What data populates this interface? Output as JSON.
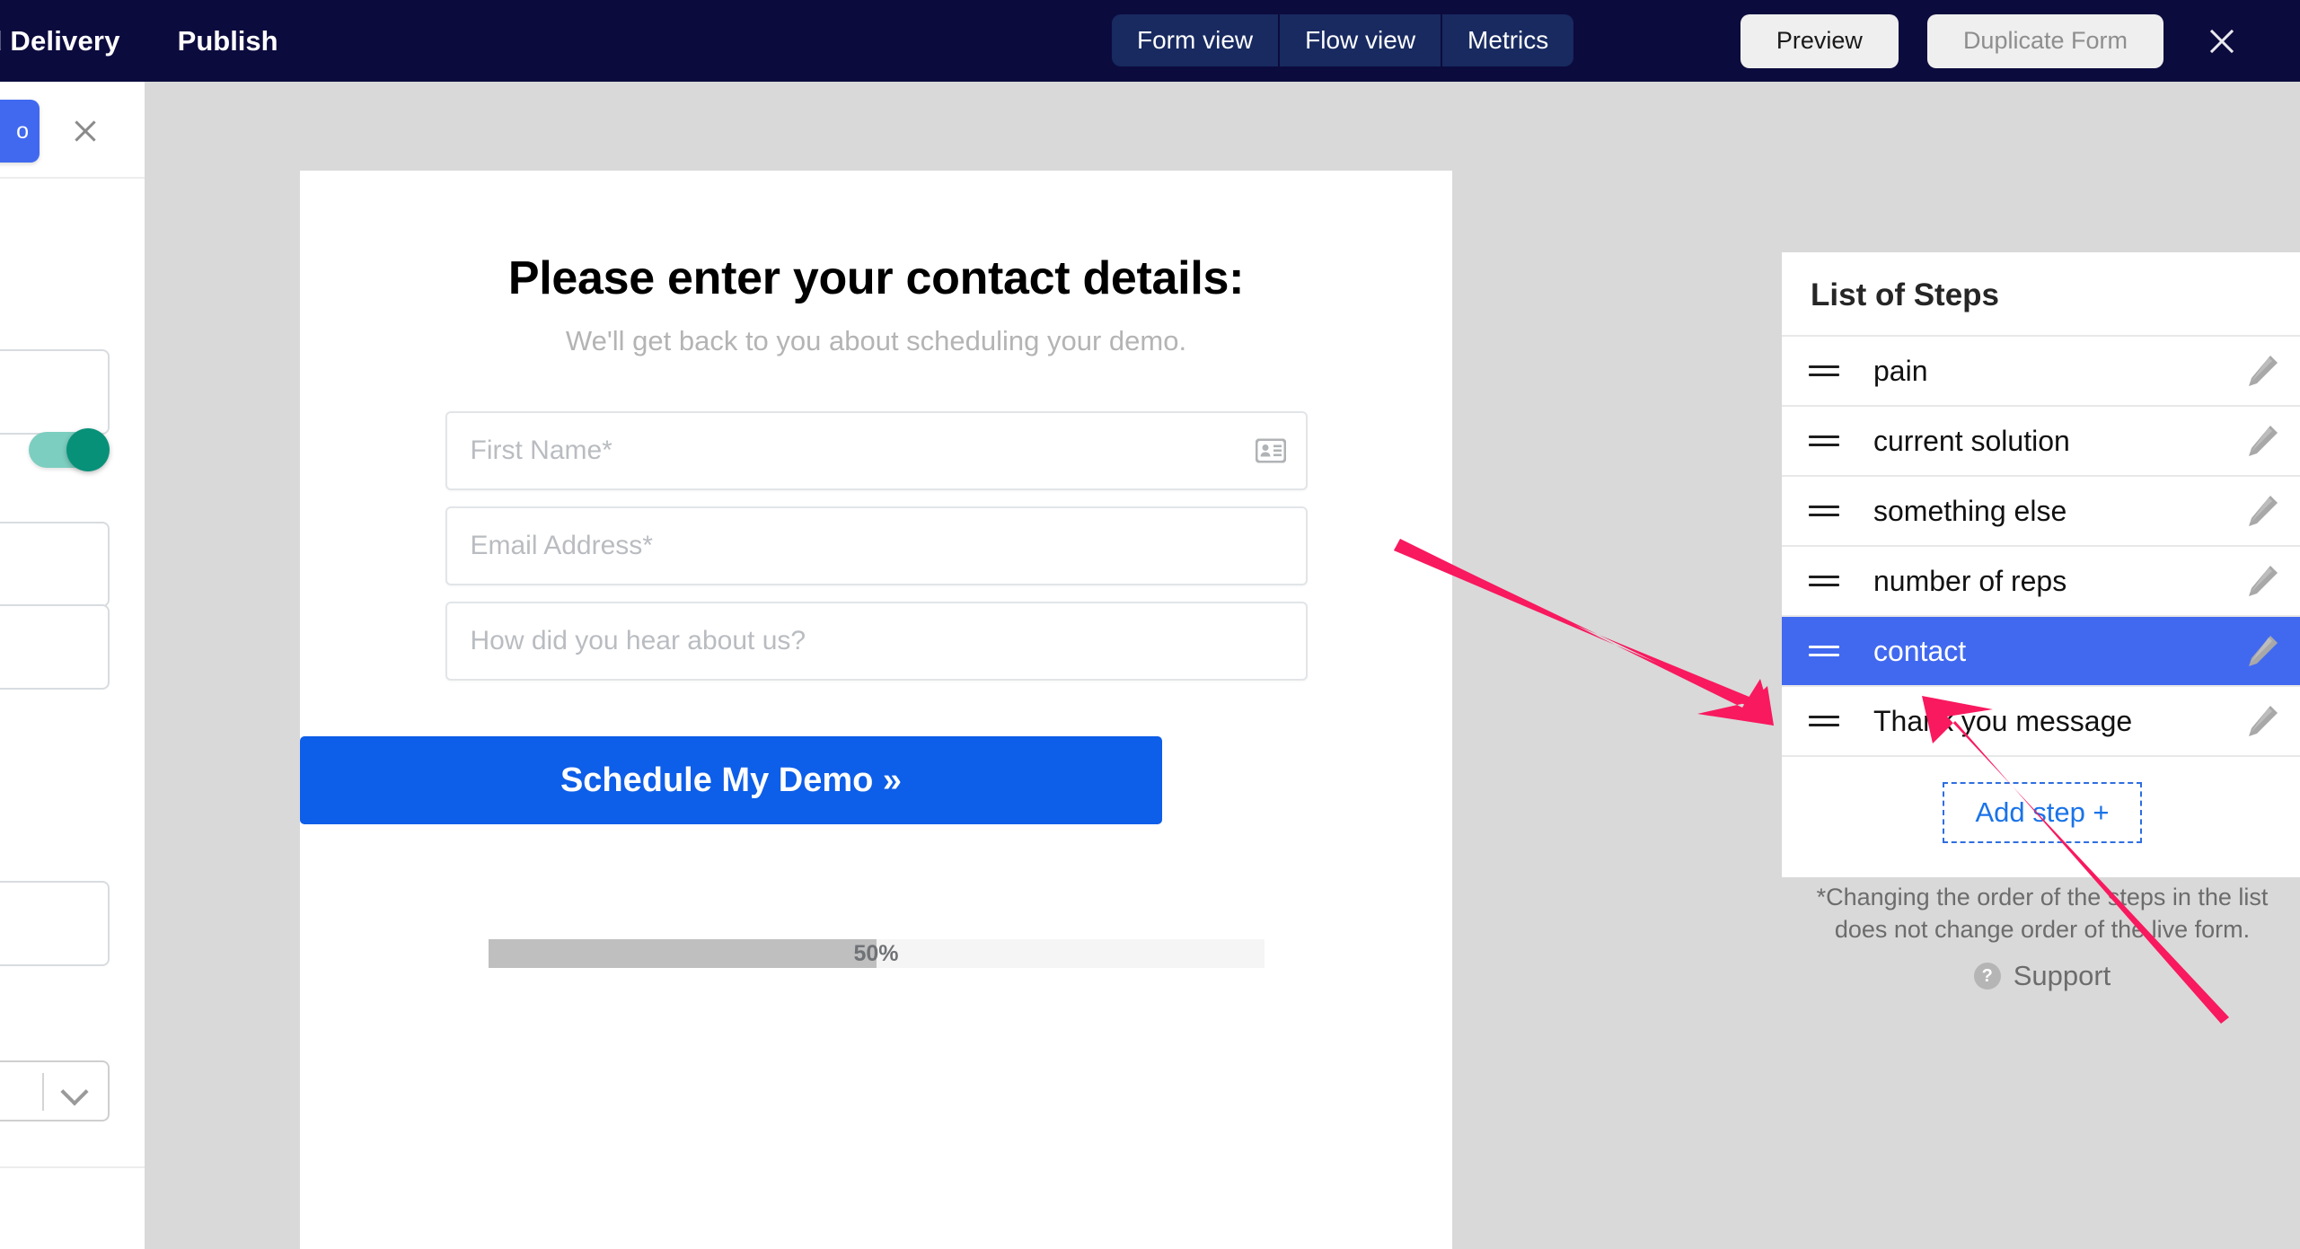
{
  "topbar": {
    "brand_title": "ad Delivery",
    "publish_label": "Publish",
    "view_tabs": [
      {
        "label": "Form view"
      },
      {
        "label": "Flow view"
      },
      {
        "label": "Metrics"
      }
    ],
    "preview_label": "Preview",
    "duplicate_label": "Duplicate Form",
    "close_icon": "close-icon"
  },
  "sidebar": {
    "blue_button_label": "o",
    "close_icon": "close-icon",
    "toggle_state": "on",
    "chevron_icon": "chevron-down-icon"
  },
  "form_preview": {
    "title": "Please enter your contact details:",
    "subtitle": "We'll get back to you about scheduling your demo.",
    "fields": [
      {
        "placeholder": "First Name*",
        "value": "",
        "icon": "contact-card-icon"
      },
      {
        "placeholder": "Email Address*",
        "value": "",
        "icon": ""
      },
      {
        "placeholder": "How did you hear about us?",
        "value": "",
        "icon": ""
      }
    ],
    "submit_label": "Schedule My Demo »",
    "progress_percent": 50,
    "progress_label": "50%"
  },
  "steps_panel": {
    "title": "List of Steps",
    "steps": [
      {
        "label": "pain",
        "active": false
      },
      {
        "label": "current solution",
        "active": false
      },
      {
        "label": "something else",
        "active": false
      },
      {
        "label": "number of reps",
        "active": false
      },
      {
        "label": "contact",
        "active": true
      },
      {
        "label": "Thank you message",
        "active": false
      }
    ],
    "add_step_label": "Add step +",
    "note_line_1": "*Changing the order of the steps in the list",
    "note_line_2": "does not change order of the live form.",
    "support_label": "Support",
    "support_icon": "question-mark-icon"
  },
  "colors": {
    "topbar_background": "#0c0b3e",
    "tab_background": "#182a60",
    "accent_blue": "#4169f0",
    "submit_blue": "#0d5ee8",
    "link_blue": "#1a73e8",
    "canvas_background": "#d9d9d9",
    "toggle_on": "#089179",
    "annotation_pink": "#f8195f"
  },
  "annotations": [
    {
      "name": "arrow-to-add-step-upper",
      "direction": "down-right"
    },
    {
      "name": "arrow-to-add-step-lower",
      "direction": "up-left"
    }
  ]
}
